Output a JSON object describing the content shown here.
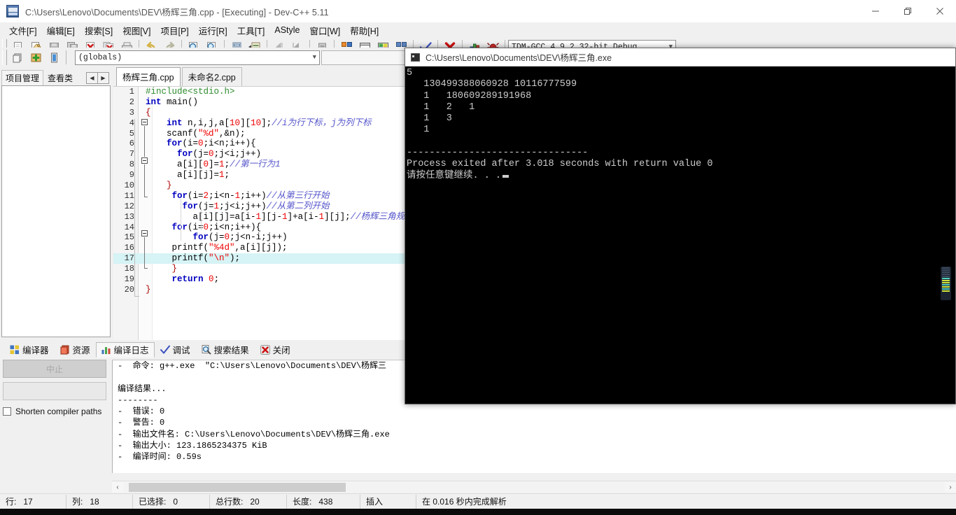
{
  "window": {
    "title": "C:\\Users\\Lenovo\\Documents\\DEV\\杨辉三角.cpp - [Executing] - Dev-C++ 5.11",
    "minimize_label": "Minimize",
    "restore_label": "Restore",
    "close_label": "Close"
  },
  "menubar": {
    "items": [
      {
        "label": "文件[F]"
      },
      {
        "label": "编辑[E]"
      },
      {
        "label": "搜索[S]"
      },
      {
        "label": "视图[V]"
      },
      {
        "label": "项目[P]"
      },
      {
        "label": "运行[R]"
      },
      {
        "label": "工具[T]"
      },
      {
        "label": "AStyle"
      },
      {
        "label": "窗口[W]"
      },
      {
        "label": "帮助[H]"
      }
    ]
  },
  "toolbar": {
    "buttons": [
      {
        "name": "new-file-icon",
        "title": "新建"
      },
      {
        "name": "open-file-icon",
        "title": "打开"
      },
      {
        "name": "save-icon",
        "title": "保存"
      },
      {
        "name": "save-all-icon",
        "title": "全部保存"
      },
      {
        "name": "close-file-icon",
        "title": "关闭"
      },
      {
        "name": "close-all-icon",
        "title": "全部关闭"
      },
      {
        "name": "print-icon",
        "title": "打印"
      },
      {
        "name": "undo-icon",
        "title": "撤销"
      },
      {
        "name": "redo-icon",
        "title": "重做"
      },
      {
        "name": "find-icon",
        "title": "查找"
      },
      {
        "name": "replace-icon",
        "title": "替换"
      },
      {
        "name": "goto-line-icon",
        "title": "转到行"
      },
      {
        "name": "indent-icon",
        "title": "缩进"
      },
      {
        "name": "back-icon",
        "title": "后退"
      },
      {
        "name": "forward-icon",
        "title": "前进"
      },
      {
        "name": "project-icon",
        "title": "项目"
      },
      {
        "name": "compile-icon",
        "title": "编译"
      },
      {
        "name": "run-icon",
        "title": "运行"
      },
      {
        "name": "compile-run-icon",
        "title": "编译运行"
      },
      {
        "name": "rebuild-icon",
        "title": "重新编译"
      },
      {
        "name": "syntax-check-icon",
        "title": "语法检查"
      },
      {
        "name": "stop-execution-icon",
        "title": "停止执行"
      },
      {
        "name": "profile-icon",
        "title": "性能分析"
      },
      {
        "name": "debug-icon",
        "title": "调试"
      }
    ],
    "compiler_select": "TDM-GCC 4.9.2 32-bit Debug",
    "row2_buttons": [
      {
        "name": "add-to-project-icon",
        "title": "添加到项目"
      },
      {
        "name": "insert-icon",
        "title": "插入"
      },
      {
        "name": "toggle-bookmark-icon",
        "title": "书签"
      }
    ],
    "scope_select": "(globals)",
    "scope_select2": ""
  },
  "left_dock": {
    "tabs": [
      {
        "label": "项目管理",
        "active": true
      },
      {
        "label": "查看类",
        "active": false
      }
    ],
    "nav_prev": "◀",
    "nav_next": "▶"
  },
  "editor": {
    "tabs": [
      {
        "label": "杨辉三角.cpp",
        "active": true
      },
      {
        "label": "未命名2.cpp",
        "active": false
      }
    ],
    "highlight_line": 17,
    "lines": [
      {
        "n": 1,
        "tokens": [
          {
            "t": "#include<stdio.h>",
            "c": "pre"
          }
        ]
      },
      {
        "n": 2,
        "tokens": [
          {
            "t": "int",
            "c": "kw"
          },
          {
            "t": " main()",
            "c": "pun"
          }
        ]
      },
      {
        "n": 3,
        "tokens": [
          {
            "t": "{",
            "c": "op"
          }
        ]
      },
      {
        "n": 4,
        "tokens": [
          {
            "t": "    ",
            "c": "pun"
          },
          {
            "t": "int",
            "c": "kw"
          },
          {
            "t": " n,i,j,a[",
            "c": "pun"
          },
          {
            "t": "10",
            "c": "num"
          },
          {
            "t": "][",
            "c": "pun"
          },
          {
            "t": "10",
            "c": "num"
          },
          {
            "t": "];",
            "c": "pun"
          },
          {
            "t": "//i为行下标，j为列下标",
            "c": "cmt"
          }
        ]
      },
      {
        "n": 5,
        "tokens": [
          {
            "t": "    scanf(",
            "c": "pun"
          },
          {
            "t": "\"%d\"",
            "c": "str"
          },
          {
            "t": ",&n);",
            "c": "pun"
          }
        ]
      },
      {
        "n": 6,
        "tokens": [
          {
            "t": "    ",
            "c": "pun"
          },
          {
            "t": "for",
            "c": "kw"
          },
          {
            "t": "(i=",
            "c": "pun"
          },
          {
            "t": "0",
            "c": "num"
          },
          {
            "t": ";i<n;i++){",
            "c": "pun"
          }
        ]
      },
      {
        "n": 7,
        "tokens": [
          {
            "t": "      ",
            "c": "pun"
          },
          {
            "t": "for",
            "c": "kw"
          },
          {
            "t": "(j=",
            "c": "pun"
          },
          {
            "t": "0",
            "c": "num"
          },
          {
            "t": ";j<i;j++)",
            "c": "pun"
          }
        ]
      },
      {
        "n": 8,
        "tokens": [
          {
            "t": "      a[i][",
            "c": "pun"
          },
          {
            "t": "0",
            "c": "num"
          },
          {
            "t": "]=",
            "c": "pun"
          },
          {
            "t": "1",
            "c": "num"
          },
          {
            "t": ";",
            "c": "pun"
          },
          {
            "t": "//第一行为1",
            "c": "cmt"
          }
        ]
      },
      {
        "n": 9,
        "tokens": [
          {
            "t": "      a[i][j]=",
            "c": "pun"
          },
          {
            "t": "1",
            "c": "num"
          },
          {
            "t": ";",
            "c": "pun"
          }
        ]
      },
      {
        "n": 10,
        "tokens": [
          {
            "t": "    ",
            "c": "pun"
          },
          {
            "t": "}",
            "c": "op"
          }
        ]
      },
      {
        "n": 11,
        "tokens": [
          {
            "t": "     ",
            "c": "pun"
          },
          {
            "t": "for",
            "c": "kw"
          },
          {
            "t": "(i=",
            "c": "pun"
          },
          {
            "t": "2",
            "c": "num"
          },
          {
            "t": ";i<n-",
            "c": "pun"
          },
          {
            "t": "1",
            "c": "num"
          },
          {
            "t": ";i++)",
            "c": "pun"
          },
          {
            "t": "//从第三行开始",
            "c": "cmt"
          }
        ]
      },
      {
        "n": 12,
        "tokens": [
          {
            "t": "       ",
            "c": "pun"
          },
          {
            "t": "for",
            "c": "kw"
          },
          {
            "t": "(j=",
            "c": "pun"
          },
          {
            "t": "1",
            "c": "num"
          },
          {
            "t": ";j<i;j++)",
            "c": "pun"
          },
          {
            "t": "//从第二列开始",
            "c": "cmt"
          }
        ]
      },
      {
        "n": 13,
        "tokens": [
          {
            "t": "         a[i][j]=a[i-",
            "c": "pun"
          },
          {
            "t": "1",
            "c": "num"
          },
          {
            "t": "][j-",
            "c": "pun"
          },
          {
            "t": "1",
            "c": "num"
          },
          {
            "t": "]+a[i-",
            "c": "pun"
          },
          {
            "t": "1",
            "c": "num"
          },
          {
            "t": "][j];",
            "c": "pun"
          },
          {
            "t": "//杨辉三角规律",
            "c": "cmt"
          }
        ]
      },
      {
        "n": 14,
        "tokens": [
          {
            "t": "     ",
            "c": "pun"
          },
          {
            "t": "for",
            "c": "kw"
          },
          {
            "t": "(i=",
            "c": "pun"
          },
          {
            "t": "0",
            "c": "num"
          },
          {
            "t": ";i<n;i++){",
            "c": "pun"
          }
        ]
      },
      {
        "n": 15,
        "tokens": [
          {
            "t": "         ",
            "c": "pun"
          },
          {
            "t": "for",
            "c": "kw"
          },
          {
            "t": "(j=",
            "c": "pun"
          },
          {
            "t": "0",
            "c": "num"
          },
          {
            "t": ";j<n-i;j++)",
            "c": "pun"
          }
        ]
      },
      {
        "n": 16,
        "tokens": [
          {
            "t": "     printf(",
            "c": "pun"
          },
          {
            "t": "\"%4d\"",
            "c": "str"
          },
          {
            "t": ",a[i][j]);",
            "c": "pun"
          }
        ]
      },
      {
        "n": 17,
        "tokens": [
          {
            "t": "     printf(",
            "c": "pun"
          },
          {
            "t": "\"\\n\"",
            "c": "str"
          },
          {
            "t": ");",
            "c": "pun"
          }
        ]
      },
      {
        "n": 18,
        "tokens": [
          {
            "t": "     ",
            "c": "pun"
          },
          {
            "t": "}",
            "c": "op"
          }
        ]
      },
      {
        "n": 19,
        "tokens": [
          {
            "t": "     ",
            "c": "pun"
          },
          {
            "t": "return",
            "c": "kw"
          },
          {
            "t": " ",
            "c": "pun"
          },
          {
            "t": "0",
            "c": "num"
          },
          {
            "t": ";",
            "c": "pun"
          }
        ]
      },
      {
        "n": 20,
        "tokens": [
          {
            "t": "}",
            "c": "op"
          }
        ]
      }
    ]
  },
  "console": {
    "title": "C:\\Users\\Lenovo\\Documents\\DEV\\杨辉三角.exe",
    "lines": [
      "5",
      "   130499388060928 10116777599",
      "   1   180609289191968",
      "   1   2   1",
      "   1   3",
      "   1",
      "",
      "--------------------------------",
      "Process exited after 3.018 seconds with return value 0",
      "请按任意键继续. . ."
    ]
  },
  "bottom_dock": {
    "tabs": [
      {
        "label": "编译器",
        "icon": "compiler-icon",
        "active": false
      },
      {
        "label": "资源",
        "icon": "resource-icon",
        "active": false
      },
      {
        "label": "编译日志",
        "icon": "log-icon",
        "active": true
      },
      {
        "label": "调试",
        "icon": "debug-check-icon",
        "active": false
      },
      {
        "label": "搜索结果",
        "icon": "search-results-icon",
        "active": false
      },
      {
        "label": "关闭",
        "icon": "close-panel-icon",
        "active": false
      }
    ],
    "abort_button": "中止",
    "shorten_paths_label": "Shorten compiler paths",
    "shorten_paths_checked": false,
    "log_lines": [
      "-  命令: g++.exe  \"C:\\Users\\Lenovo\\Documents\\DEV\\杨辉三",
      "",
      "编译结果...",
      "--------",
      "-  错误: 0",
      "-  警告: 0",
      "-  输出文件名: C:\\Users\\Lenovo\\Documents\\DEV\\杨辉三角.exe",
      "-  输出大小: 123.1865234375 KiB",
      "-  编译时间: 0.59s"
    ]
  },
  "statusbar": {
    "cells": [
      {
        "label": "行:",
        "value": "17"
      },
      {
        "label": "列:",
        "value": "18"
      },
      {
        "label": "已选择:",
        "value": "0"
      },
      {
        "label": "总行数:",
        "value": "20"
      },
      {
        "label": "长度:",
        "value": "438"
      },
      {
        "label": "插入",
        "value": ""
      },
      {
        "label": "在 0.016 秒内完成解析",
        "value": ""
      }
    ]
  },
  "colors": {
    "accent": "#0000c0",
    "string": "#ee0000",
    "comment": "#5555cc",
    "preproc": "#2e8b2e",
    "highlight_line": "#d6f3f5",
    "console_bg": "#000000",
    "console_fg": "#cccccc"
  }
}
